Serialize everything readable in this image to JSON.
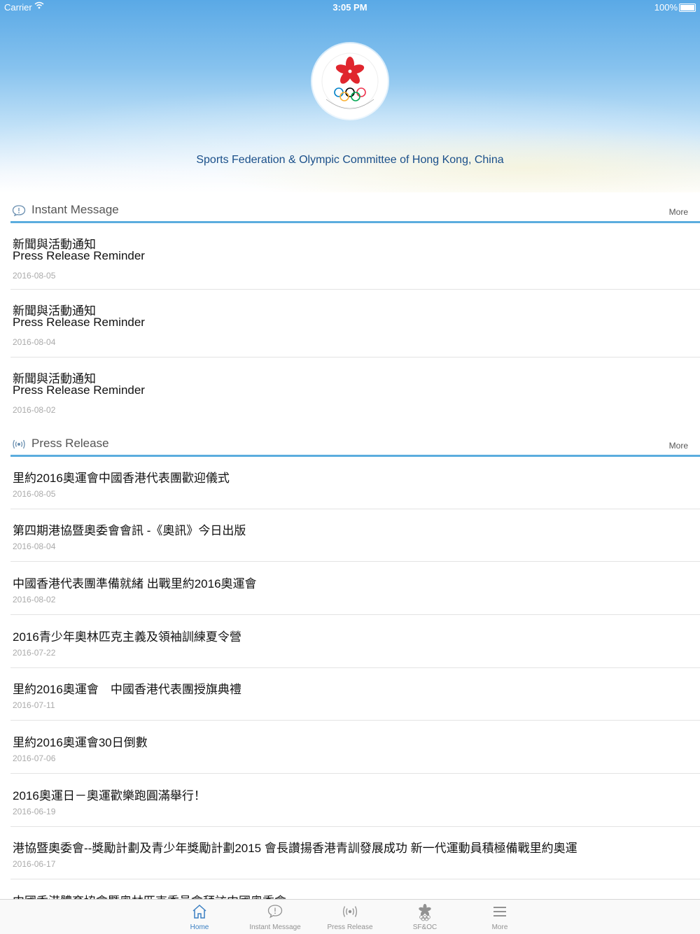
{
  "status_bar": {
    "carrier": "Carrier",
    "time": "3:05 PM",
    "battery": "100%"
  },
  "header": {
    "organization": "Sports Federation & Olympic Committee of Hong Kong, China"
  },
  "instant_message": {
    "title": "Instant Message",
    "more_label": "More",
    "items": [
      {
        "title_zh": "新聞與活動通知",
        "title_en": "Press Release Reminder",
        "date": "2016-08-05"
      },
      {
        "title_zh": "新聞與活動通知",
        "title_en": "Press Release Reminder",
        "date": "2016-08-04"
      },
      {
        "title_zh": "新聞與活動通知",
        "title_en": "Press Release Reminder",
        "date": "2016-08-02"
      }
    ]
  },
  "press_release": {
    "title": "Press Release",
    "more_label": "More",
    "items": [
      {
        "title": "里約2016奧運會中國香港代表團歡迎儀式",
        "date": "2016-08-05"
      },
      {
        "title": "第四期港協暨奧委會會訊 -《奧訊》今日出版",
        "date": "2016-08-04"
      },
      {
        "title": "中國香港代表團準備就緒 出戰里約2016奧運會",
        "date": "2016-08-02"
      },
      {
        "title": "2016青少年奧林匹克主義及領袖訓練夏令營",
        "date": "2016-07-22"
      },
      {
        "title": "里約2016奧運會　中國香港代表團授旗典禮",
        "date": "2016-07-11"
      },
      {
        "title": "里約2016奧運會30日倒數",
        "date": "2016-07-06"
      },
      {
        "title": "2016奧運日－奧運歡樂跑圓滿舉行！",
        "date": "2016-06-19"
      },
      {
        "title": "港協暨奧委會--獎勵計劃及青少年獎勵計劃2015 會長讚揚香港青訓發展成功 新一代運動員積極備戰里約奧運",
        "date": "2016-06-17"
      },
      {
        "title": "中國香港體育協會暨奧林匹克委員會拜訪中國奧委會",
        "date": ""
      }
    ]
  },
  "tab_bar": {
    "tabs": [
      {
        "label": "Home",
        "icon": "home-icon",
        "active": true
      },
      {
        "label": "Instant Message",
        "icon": "speech-bubble-icon",
        "active": false
      },
      {
        "label": "Press Release",
        "icon": "broadcast-icon",
        "active": false
      },
      {
        "label": "SF&OC",
        "icon": "bauhinia-olympic-icon",
        "active": false
      },
      {
        "label": "More",
        "icon": "menu-icon",
        "active": false
      }
    ]
  },
  "colors": {
    "accent": "#5badde",
    "active_tab": "#3a7fc2",
    "org_name": "#1a4f8a",
    "logo_red": "#e0262e"
  }
}
